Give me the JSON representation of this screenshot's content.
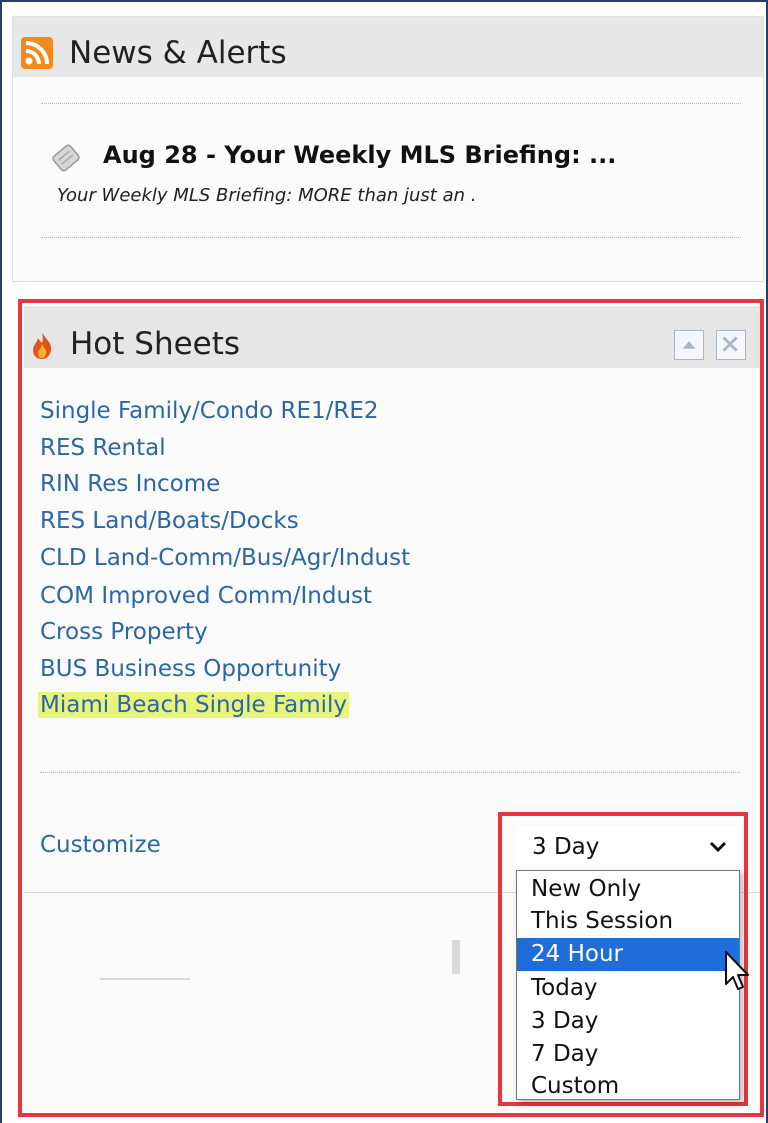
{
  "news": {
    "title": "News & Alerts",
    "item_title": "Aug 28 - Your Weekly MLS Briefing: ...",
    "item_snippet": "Your Weekly MLS Briefing:  MORE  than just an ."
  },
  "hot_sheets": {
    "title": "Hot Sheets",
    "links": [
      "Single Family/Condo RE1/RE2",
      "RES Rental",
      "RIN Res Income",
      "RES Land/Boats/Docks",
      "CLD Land-Comm/Bus/Agr/Indust",
      "COM Improved Comm/Indust",
      "Cross Property",
      "BUS Business Opportunity",
      "Miami Beach Single Family"
    ],
    "customize_label": "Customize",
    "select": {
      "value": "3 Day",
      "options": [
        "New Only",
        "This Session",
        "24 Hour",
        "Today",
        "3 Day",
        "7 Day",
        "Custom"
      ],
      "highlighted": "24 Hour"
    }
  },
  "colors": {
    "link": "#2b66a9",
    "highlight_bg": "#e8f57a",
    "annotation_border": "#e8363e",
    "selected_option": "#1f6ddb"
  },
  "icons": [
    "rss-icon",
    "tag-icon",
    "fire-icon",
    "collapse-up-icon",
    "close-icon",
    "chevron-down-icon",
    "mouse-cursor-icon"
  ]
}
